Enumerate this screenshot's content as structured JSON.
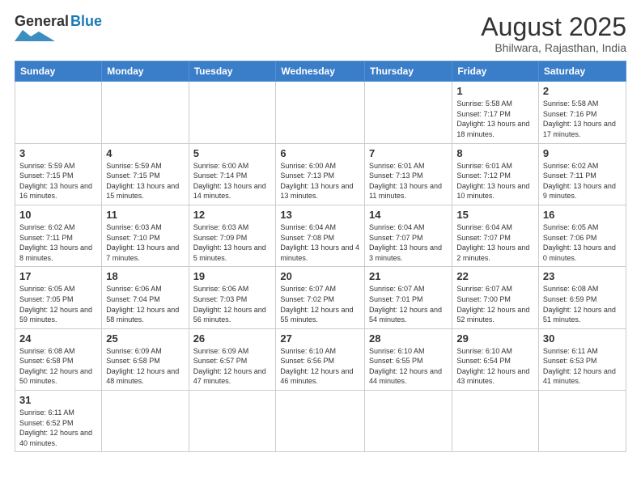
{
  "logo": {
    "general": "General",
    "blue": "Blue"
  },
  "header": {
    "month_year": "August 2025",
    "location": "Bhilwara, Rajasthan, India"
  },
  "days_of_week": [
    "Sunday",
    "Monday",
    "Tuesday",
    "Wednesday",
    "Thursday",
    "Friday",
    "Saturday"
  ],
  "weeks": [
    [
      {
        "day": "",
        "info": ""
      },
      {
        "day": "",
        "info": ""
      },
      {
        "day": "",
        "info": ""
      },
      {
        "day": "",
        "info": ""
      },
      {
        "day": "",
        "info": ""
      },
      {
        "day": "1",
        "info": "Sunrise: 5:58 AM\nSunset: 7:17 PM\nDaylight: 13 hours and 18 minutes."
      },
      {
        "day": "2",
        "info": "Sunrise: 5:58 AM\nSunset: 7:16 PM\nDaylight: 13 hours and 17 minutes."
      }
    ],
    [
      {
        "day": "3",
        "info": "Sunrise: 5:59 AM\nSunset: 7:15 PM\nDaylight: 13 hours and 16 minutes."
      },
      {
        "day": "4",
        "info": "Sunrise: 5:59 AM\nSunset: 7:15 PM\nDaylight: 13 hours and 15 minutes."
      },
      {
        "day": "5",
        "info": "Sunrise: 6:00 AM\nSunset: 7:14 PM\nDaylight: 13 hours and 14 minutes."
      },
      {
        "day": "6",
        "info": "Sunrise: 6:00 AM\nSunset: 7:13 PM\nDaylight: 13 hours and 13 minutes."
      },
      {
        "day": "7",
        "info": "Sunrise: 6:01 AM\nSunset: 7:13 PM\nDaylight: 13 hours and 11 minutes."
      },
      {
        "day": "8",
        "info": "Sunrise: 6:01 AM\nSunset: 7:12 PM\nDaylight: 13 hours and 10 minutes."
      },
      {
        "day": "9",
        "info": "Sunrise: 6:02 AM\nSunset: 7:11 PM\nDaylight: 13 hours and 9 minutes."
      }
    ],
    [
      {
        "day": "10",
        "info": "Sunrise: 6:02 AM\nSunset: 7:11 PM\nDaylight: 13 hours and 8 minutes."
      },
      {
        "day": "11",
        "info": "Sunrise: 6:03 AM\nSunset: 7:10 PM\nDaylight: 13 hours and 7 minutes."
      },
      {
        "day": "12",
        "info": "Sunrise: 6:03 AM\nSunset: 7:09 PM\nDaylight: 13 hours and 5 minutes."
      },
      {
        "day": "13",
        "info": "Sunrise: 6:04 AM\nSunset: 7:08 PM\nDaylight: 13 hours and 4 minutes."
      },
      {
        "day": "14",
        "info": "Sunrise: 6:04 AM\nSunset: 7:07 PM\nDaylight: 13 hours and 3 minutes."
      },
      {
        "day": "15",
        "info": "Sunrise: 6:04 AM\nSunset: 7:07 PM\nDaylight: 13 hours and 2 minutes."
      },
      {
        "day": "16",
        "info": "Sunrise: 6:05 AM\nSunset: 7:06 PM\nDaylight: 13 hours and 0 minutes."
      }
    ],
    [
      {
        "day": "17",
        "info": "Sunrise: 6:05 AM\nSunset: 7:05 PM\nDaylight: 12 hours and 59 minutes."
      },
      {
        "day": "18",
        "info": "Sunrise: 6:06 AM\nSunset: 7:04 PM\nDaylight: 12 hours and 58 minutes."
      },
      {
        "day": "19",
        "info": "Sunrise: 6:06 AM\nSunset: 7:03 PM\nDaylight: 12 hours and 56 minutes."
      },
      {
        "day": "20",
        "info": "Sunrise: 6:07 AM\nSunset: 7:02 PM\nDaylight: 12 hours and 55 minutes."
      },
      {
        "day": "21",
        "info": "Sunrise: 6:07 AM\nSunset: 7:01 PM\nDaylight: 12 hours and 54 minutes."
      },
      {
        "day": "22",
        "info": "Sunrise: 6:07 AM\nSunset: 7:00 PM\nDaylight: 12 hours and 52 minutes."
      },
      {
        "day": "23",
        "info": "Sunrise: 6:08 AM\nSunset: 6:59 PM\nDaylight: 12 hours and 51 minutes."
      }
    ],
    [
      {
        "day": "24",
        "info": "Sunrise: 6:08 AM\nSunset: 6:58 PM\nDaylight: 12 hours and 50 minutes."
      },
      {
        "day": "25",
        "info": "Sunrise: 6:09 AM\nSunset: 6:58 PM\nDaylight: 12 hours and 48 minutes."
      },
      {
        "day": "26",
        "info": "Sunrise: 6:09 AM\nSunset: 6:57 PM\nDaylight: 12 hours and 47 minutes."
      },
      {
        "day": "27",
        "info": "Sunrise: 6:10 AM\nSunset: 6:56 PM\nDaylight: 12 hours and 46 minutes."
      },
      {
        "day": "28",
        "info": "Sunrise: 6:10 AM\nSunset: 6:55 PM\nDaylight: 12 hours and 44 minutes."
      },
      {
        "day": "29",
        "info": "Sunrise: 6:10 AM\nSunset: 6:54 PM\nDaylight: 12 hours and 43 minutes."
      },
      {
        "day": "30",
        "info": "Sunrise: 6:11 AM\nSunset: 6:53 PM\nDaylight: 12 hours and 41 minutes."
      }
    ],
    [
      {
        "day": "31",
        "info": "Sunrise: 6:11 AM\nSunset: 6:52 PM\nDaylight: 12 hours and 40 minutes."
      },
      {
        "day": "",
        "info": ""
      },
      {
        "day": "",
        "info": ""
      },
      {
        "day": "",
        "info": ""
      },
      {
        "day": "",
        "info": ""
      },
      {
        "day": "",
        "info": ""
      },
      {
        "day": "",
        "info": ""
      }
    ]
  ]
}
